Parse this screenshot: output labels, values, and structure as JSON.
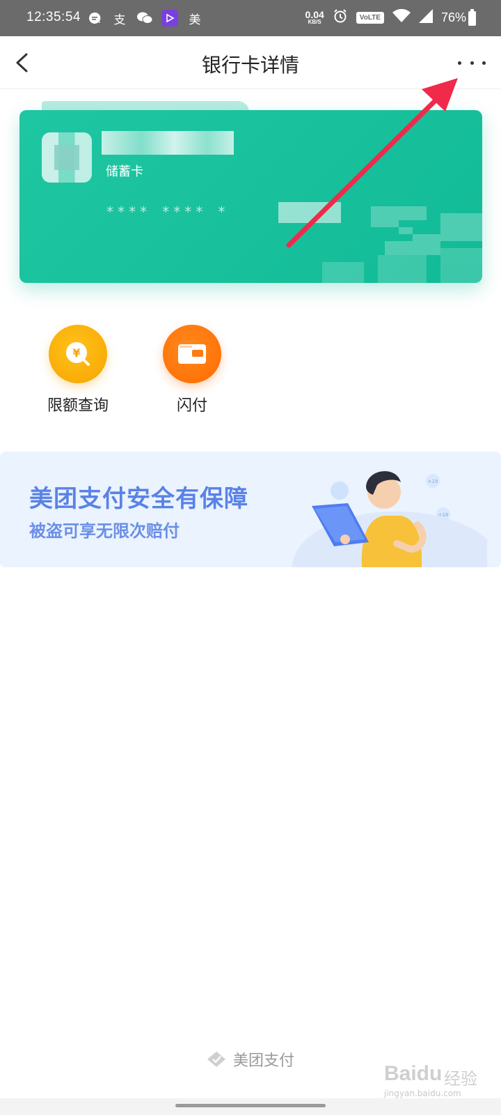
{
  "status_bar": {
    "time": "12:35:54",
    "app_icon_mei": "美",
    "app_icon_zhi": "支",
    "net_speed_value": "0.04",
    "net_speed_unit": "KB/S",
    "volte": "VoLTE",
    "battery_percent": "76%"
  },
  "nav": {
    "title": "银行卡详情"
  },
  "card": {
    "type_label": "储蓄卡",
    "number_masked": "****  ****  *",
    "colors": {
      "card": "#12bb97",
      "tab": "#b8ece0"
    }
  },
  "actions": [
    {
      "label": "限额查询",
      "icon": "yuan-search-icon",
      "color": "#f7a300"
    },
    {
      "label": "闪付",
      "icon": "wallet-icon",
      "color": "#ff6a00"
    }
  ],
  "banner": {
    "title": "美团支付安全有保障",
    "subtitle": "被盗可享无限次赔付",
    "badge_1": "+19",
    "badge_2": "+18",
    "colors": {
      "background": "#eaf3fe",
      "text": "#5a82e6"
    }
  },
  "footer": {
    "brand": "美团支付"
  },
  "watermark": {
    "brand": "Baidu",
    "cn": "经验",
    "domain": "jingyan.baidu.com"
  }
}
